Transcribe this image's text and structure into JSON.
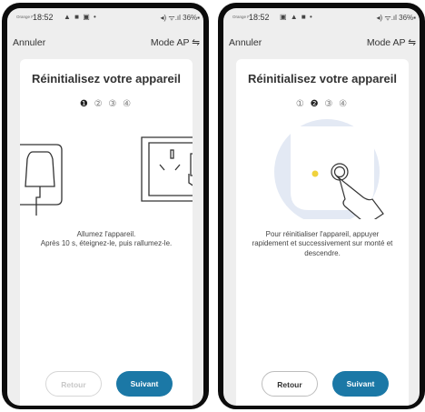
{
  "colors": {
    "accent": "#1b78a6",
    "indicator": "#f0d23c"
  },
  "screens": [
    {
      "status": {
        "carrier": "Orange F",
        "time": "18:52",
        "notif": "▲ ■ ▣ •",
        "system": "◂) ᯤ.ıl 36%▪"
      },
      "topbar": {
        "cancel": "Annuler",
        "mode": "Mode AP ⇋"
      },
      "title": "Réinitialisez votre appareil",
      "steps": {
        "s1": "❶",
        "s2": "②",
        "s3": "③",
        "s4": "④"
      },
      "illustration": "plug-and-wall-socket",
      "description": "Allumez l'appareil.\nAprès 10 s, éteignez-le, puis rallumez-le.",
      "buttons": {
        "back": "Retour",
        "next": "Suivant"
      }
    },
    {
      "status": {
        "carrier": "Orange F",
        "time": "18:52",
        "notif": "▣ ▲ ■ •",
        "system": "◂) ᯤ.ıl 36%▪"
      },
      "topbar": {
        "cancel": "Annuler",
        "mode": "Mode AP ⇋"
      },
      "title": "Réinitialisez votre appareil",
      "steps": {
        "s1": "①",
        "s2": "❷",
        "s3": "③",
        "s4": "④"
      },
      "illustration": "finger-pressing-device-button",
      "description": "Pour réinitialiser l'appareil, appuyer rapidement et successivement sur monté et descendre.",
      "buttons": {
        "back": "Retour",
        "next": "Suivant"
      }
    }
  ]
}
